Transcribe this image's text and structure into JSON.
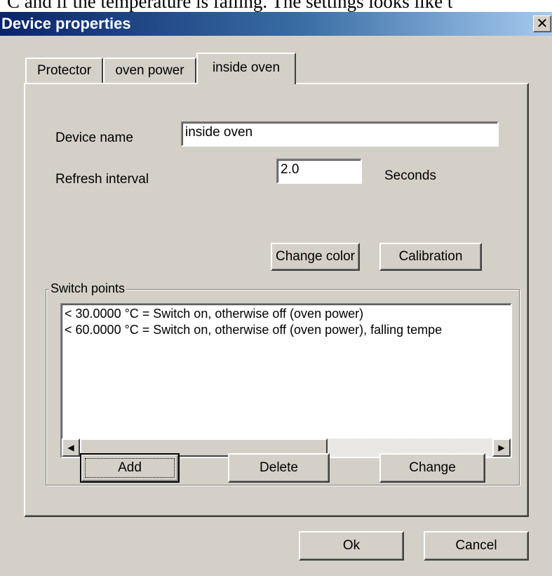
{
  "background_text": "C and if the temperature is falling. The settings looks like t",
  "dialog": {
    "title": "Device properties",
    "close_glyph": "✕"
  },
  "tabs": [
    {
      "label": "Protector",
      "active": false
    },
    {
      "label": "oven power",
      "active": false
    },
    {
      "label": "inside oven",
      "active": true
    }
  ],
  "form": {
    "device_name_label": "Device name",
    "device_name_value": "inside oven",
    "refresh_interval_label": "Refresh interval",
    "refresh_interval_value": "2.0",
    "refresh_unit": "Seconds"
  },
  "buttons": {
    "change_color": "Change color",
    "calibration": "Calibration",
    "add": "Add",
    "delete": "Delete",
    "change": "Change",
    "ok": "Ok",
    "cancel": "Cancel"
  },
  "switch_points": {
    "legend": "Switch points",
    "items": [
      "< 30.0000 °C = Switch on, otherwise off (oven power)",
      "< 60.0000 °C = Switch on, otherwise off (oven power), falling tempe"
    ]
  },
  "scrollbar": {
    "left_arrow": "◀",
    "right_arrow": "▶",
    "thumb_fraction": 0.6
  },
  "colors": {
    "dialog_face": "#d4d0c8",
    "title_start": "#0a246a",
    "title_end": "#a6caf0"
  }
}
